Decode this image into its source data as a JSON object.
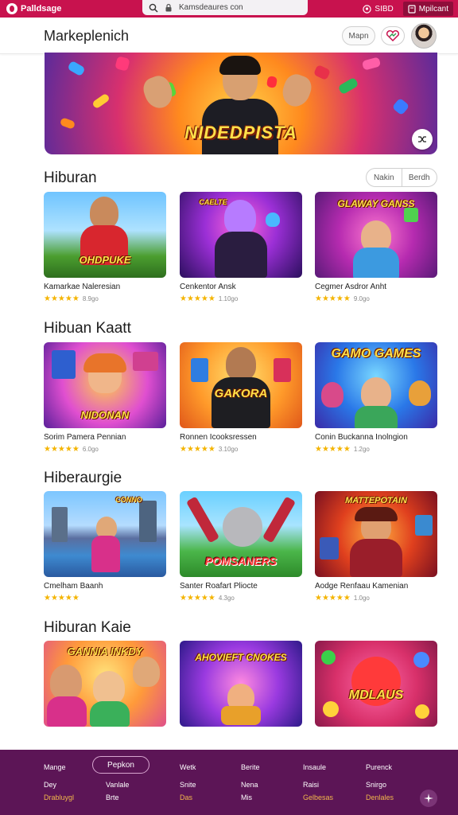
{
  "browser": {
    "logo_text": "Palldsage",
    "url": "Kamsdeaures con",
    "action1": "SIBD",
    "action2": "Mpilcant"
  },
  "header": {
    "title": "Markeplenich",
    "map_button": "Mapn"
  },
  "hero": {
    "title": "NIDEDPISTA"
  },
  "segment": {
    "left": "Nakin",
    "right": "Berdh"
  },
  "sections": [
    {
      "title": "Hiburan",
      "cards": [
        {
          "thumb_text": "OHDPUKE",
          "title": "Kamarkae Naleresian",
          "rating": "8.9go"
        },
        {
          "thumb_text": "CAELTE",
          "title": "Cenkentor Ansk",
          "rating": "1.10go"
        },
        {
          "thumb_text": "GLAWAY GANSS",
          "title": "Cegmer Asdror Anht",
          "rating": "9.0go"
        }
      ]
    },
    {
      "title": "Hibuan Kaatt",
      "cards": [
        {
          "thumb_text": "NIDONAN",
          "title": "Sorim Pamera Pennian",
          "rating": "6.0go"
        },
        {
          "thumb_text": "GAKORA",
          "title": "Ronnen Icooksressen",
          "rating": "3.10go"
        },
        {
          "thumb_text": "GAMO GAMES",
          "title": "Conin Buckanna Inolngion",
          "rating": "1.2go"
        }
      ]
    },
    {
      "title": "Hiberaurgie",
      "cards": [
        {
          "thumb_text": "CONNO",
          "title": "Cmelham Baanh",
          "rating": ""
        },
        {
          "thumb_text": "POMSANERS",
          "title": "Santer Roafart Pliocte",
          "rating": "4.3go"
        },
        {
          "thumb_text": "MATTEPOTAIN",
          "title": "Aodge Renfaau Kamenian",
          "rating": "1.0go"
        }
      ]
    },
    {
      "title": "Hiburan Kaie",
      "cards": [
        {
          "thumb_text": "GANNIA INKDY",
          "title": "",
          "rating": ""
        },
        {
          "thumb_text": "AHOVIEFT CNOKES",
          "title": "",
          "rating": ""
        },
        {
          "thumb_text": "MDLAUS",
          "title": "",
          "rating": ""
        }
      ]
    }
  ],
  "footer": {
    "button": "Pepkon",
    "col1": [
      "Mange",
      "Dey",
      "Drabluygl"
    ],
    "col2": [
      "Vanlale",
      "Brte"
    ],
    "col3": [
      "Wetk",
      "Snite",
      "Das"
    ],
    "col4": [
      "Berite",
      "Nena",
      "Mis"
    ],
    "col5": [
      "Insaule",
      "Raisi",
      "Gelbesas"
    ],
    "col6": [
      "Purenck",
      "Snirgo",
      "Denlales"
    ]
  }
}
